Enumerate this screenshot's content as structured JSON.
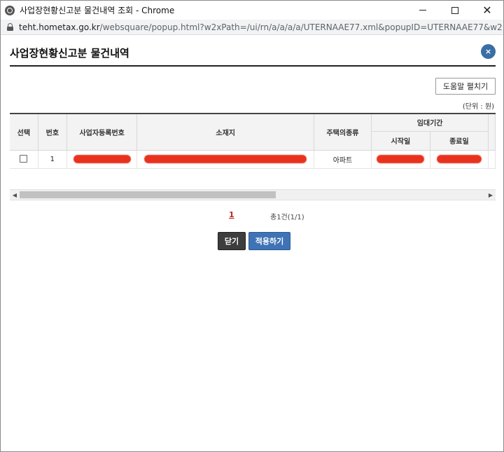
{
  "window": {
    "title": "사업장현황신고분 물건내역 조회 - Chrome",
    "url_host": "teht.hometax.go.kr",
    "url_rest": "/websquare/popup.html?w2xPath=/ui/rn/a/a/a/a/UTERNAAE77.xml&popupID=UTERNAAE77&w2xHome=..."
  },
  "popup": {
    "title": "사업장현황신고분 물건내역",
    "close_icon": "×",
    "help_button": "도움말 펼치기",
    "unit": "(단위 : 원)"
  },
  "table": {
    "headers": {
      "select": "선택",
      "number": "번호",
      "biz_reg_no": "사업자등록번호",
      "address": "소재지",
      "housing_type": "주택의종류",
      "lease_period": "임대기간",
      "start_date": "시작일",
      "end_date": "종료일"
    },
    "rows": [
      {
        "number": "1",
        "housing_type": "아파트"
      }
    ]
  },
  "pagination": {
    "current_page": "1",
    "total": "총1건(1/1)"
  },
  "buttons": {
    "close": "닫기",
    "apply": "적용하기"
  },
  "colors": {
    "accent_blue": "#3f73b5",
    "dark_button": "#3d3d3d",
    "redaction": "#e8321d"
  }
}
